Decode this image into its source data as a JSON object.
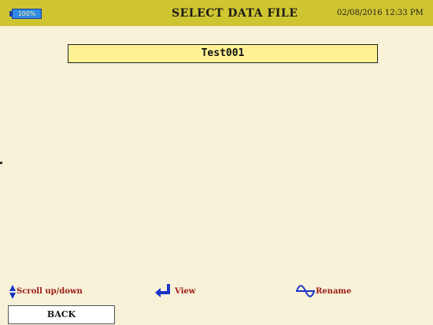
{
  "header": {
    "battery_level": "100%",
    "title": "SELECT DATA FILE",
    "datetime": "02/08/2016 12:33 PM"
  },
  "files": [
    {
      "name": "Test001",
      "selected": true
    }
  ],
  "help": {
    "scroll_label": "Scroll up/down",
    "view_label": "View",
    "rename_label": "Rename"
  },
  "buttons": {
    "back_label": "BACK"
  },
  "icons": {
    "battery": "battery-icon",
    "scroll": "up-down-arrows-icon",
    "view": "enter-arrow-icon",
    "rename": "sine-wave-icon"
  },
  "colors": {
    "header_bar": "#cfc531",
    "background": "#f8f2d9",
    "selected_row": "#fff294",
    "help_text": "#9b1b15",
    "icon_blue": "#1b35c8"
  }
}
